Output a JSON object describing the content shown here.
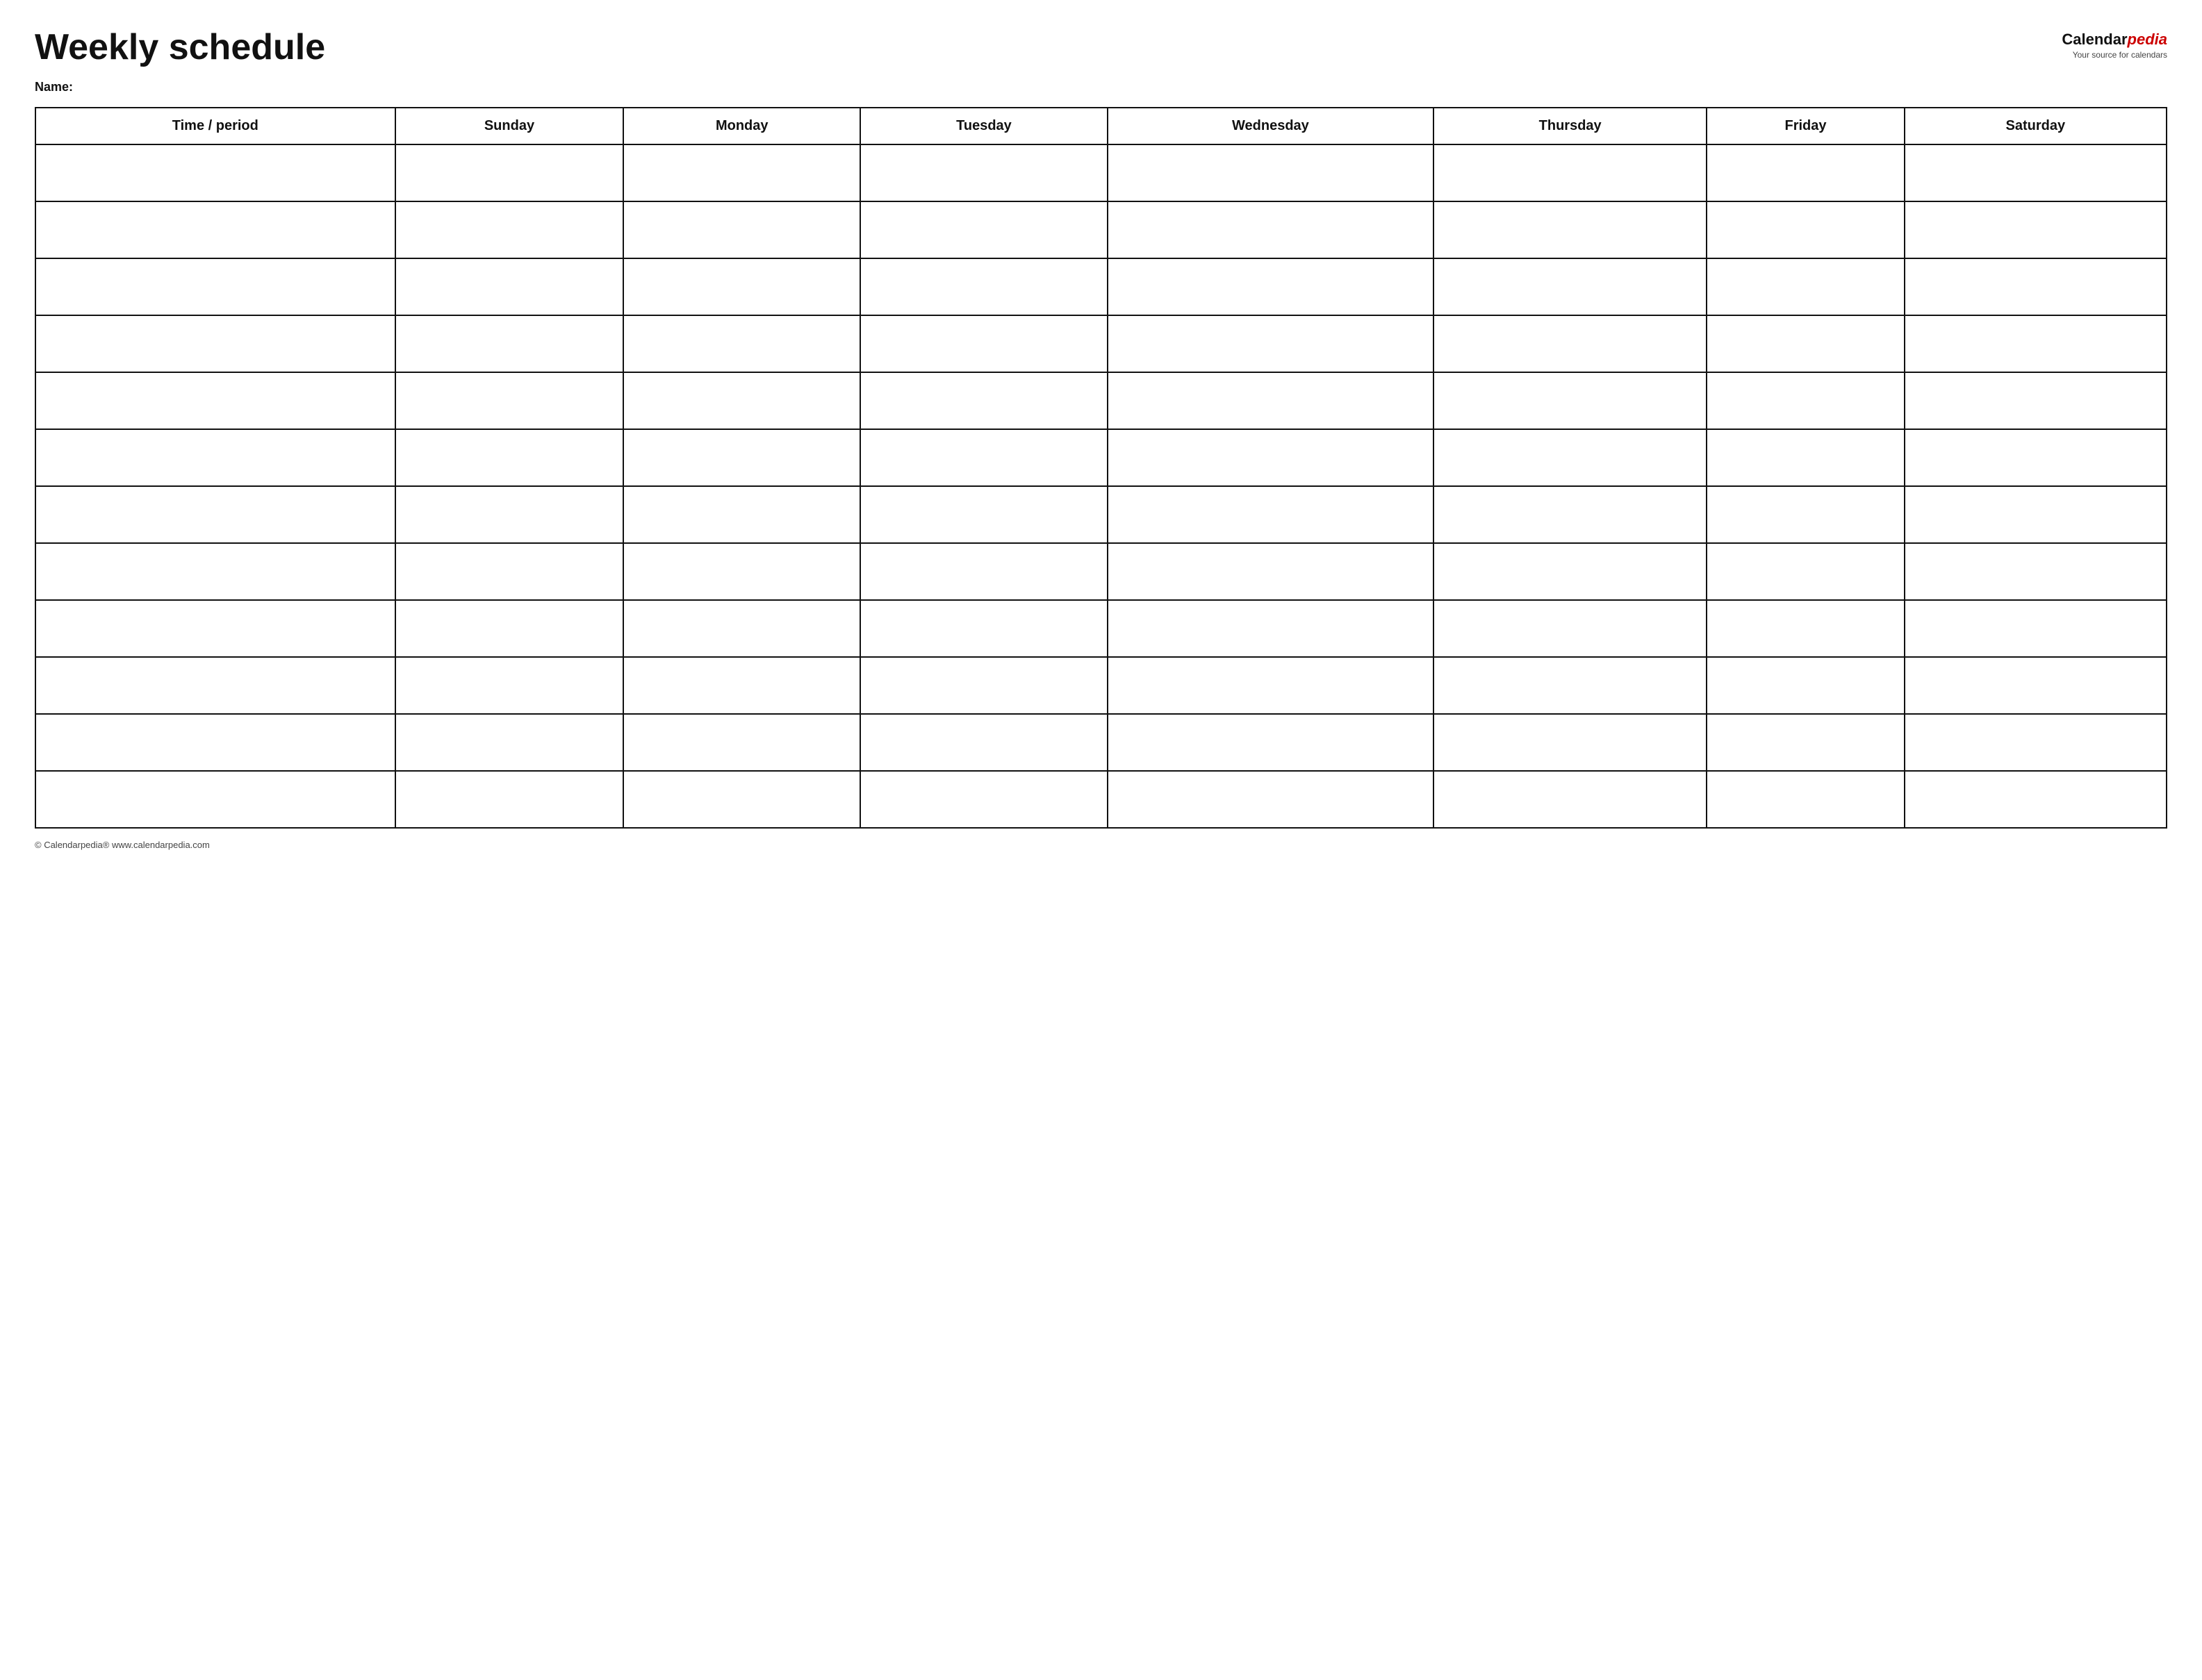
{
  "header": {
    "title": "Weekly schedule",
    "logo": {
      "calendar_text": "Calendar",
      "pedia_text": "pedia",
      "subtitle": "Your source for calendars"
    },
    "name_label": "Name:"
  },
  "table": {
    "columns": [
      "Time / period",
      "Sunday",
      "Monday",
      "Tuesday",
      "Wednesday",
      "Thursday",
      "Friday",
      "Saturday"
    ],
    "row_count": 12
  },
  "footer": {
    "copyright": "© Calendarpedia®  www.calendarpedia.com"
  }
}
